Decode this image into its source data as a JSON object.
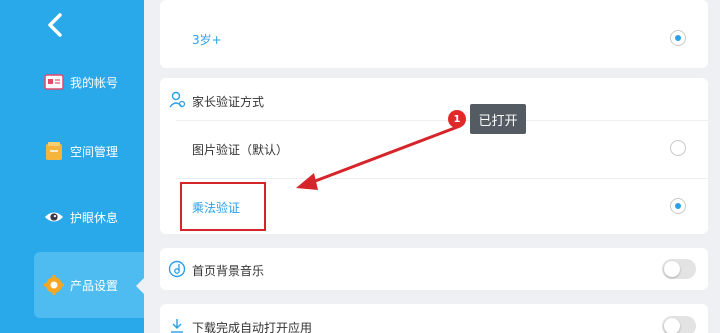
{
  "sidebar": {
    "items": [
      {
        "label": "我的帐号",
        "icon": "account-icon"
      },
      {
        "label": "空间管理",
        "icon": "storage-icon"
      },
      {
        "label": "护眼休息",
        "icon": "eye-icon"
      },
      {
        "label": "产品设置",
        "icon": "gear-icon"
      }
    ]
  },
  "age": {
    "option_label": "3岁+"
  },
  "parent_verify": {
    "title": "家长验证方式",
    "options": [
      {
        "label": "图片验证（默认）"
      },
      {
        "label": "乘法验证"
      }
    ]
  },
  "home_music": {
    "title": "首页背景音乐"
  },
  "auto_open": {
    "title": "下载完成自动打开应用"
  },
  "annotation": {
    "badge": "1",
    "tooltip": "已打开"
  },
  "colors": {
    "accent": "#29a8ea",
    "annotation_red": "#d6252a"
  }
}
